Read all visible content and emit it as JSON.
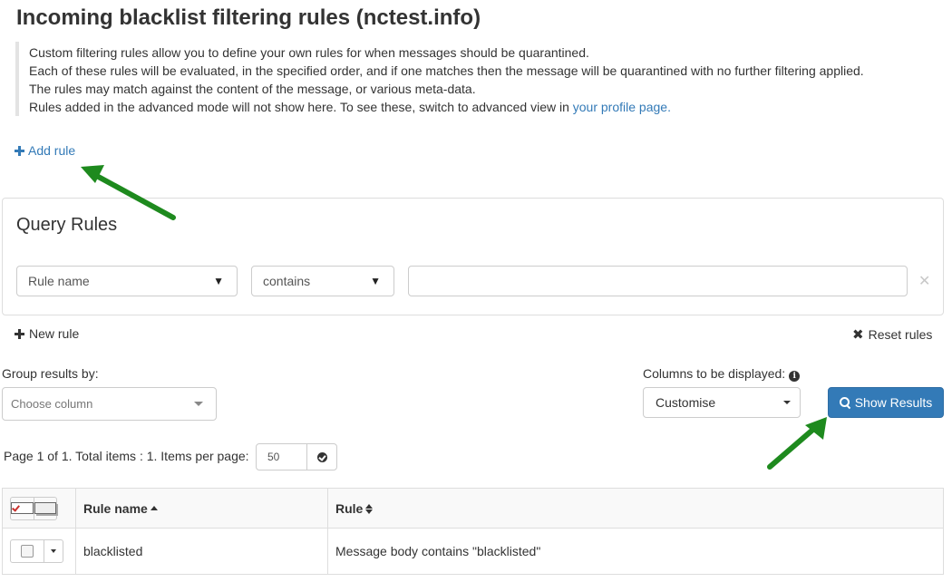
{
  "page": {
    "title": "Incoming blacklist filtering rules (nctest.info)",
    "description_lines": [
      "Custom filtering rules allow you to define your own rules for when messages should be quarantined.",
      "Each of these rules will be evaluated, in the specified order, and if one matches then the message will be quarantined with no further filtering applied.",
      "The rules may match against the content of the message, or various meta-data."
    ],
    "advanced_note": "Rules added in the advanced mode will not show here. To see these, switch to advanced view in",
    "profile_link": "your profile page",
    "profile_link_suffix": ".",
    "add_rule_label": "Add rule"
  },
  "query": {
    "title": "Query Rules",
    "field_select": "Rule name",
    "operator_select": "contains",
    "value": "",
    "new_rule_label": "New rule",
    "reset_rules_label": "Reset rules"
  },
  "controls": {
    "group_by_label": "Group results by:",
    "group_by_placeholder": "Choose column",
    "columns_label": "Columns to be displayed:",
    "columns_select": "Customise",
    "show_results_label": "Show Results"
  },
  "pagination": {
    "summary": "Page 1 of 1. Total items : 1. Items per page:",
    "per_page": "50"
  },
  "table": {
    "headers": {
      "name": "Rule name",
      "rule": "Rule"
    },
    "rows": [
      {
        "name": "blacklisted",
        "rule": "Message body contains \"blacklisted\""
      }
    ]
  },
  "colors": {
    "link": "#337ab7",
    "primary_button": "#337ab7",
    "annotation_arrow": "#1e8a1e"
  }
}
